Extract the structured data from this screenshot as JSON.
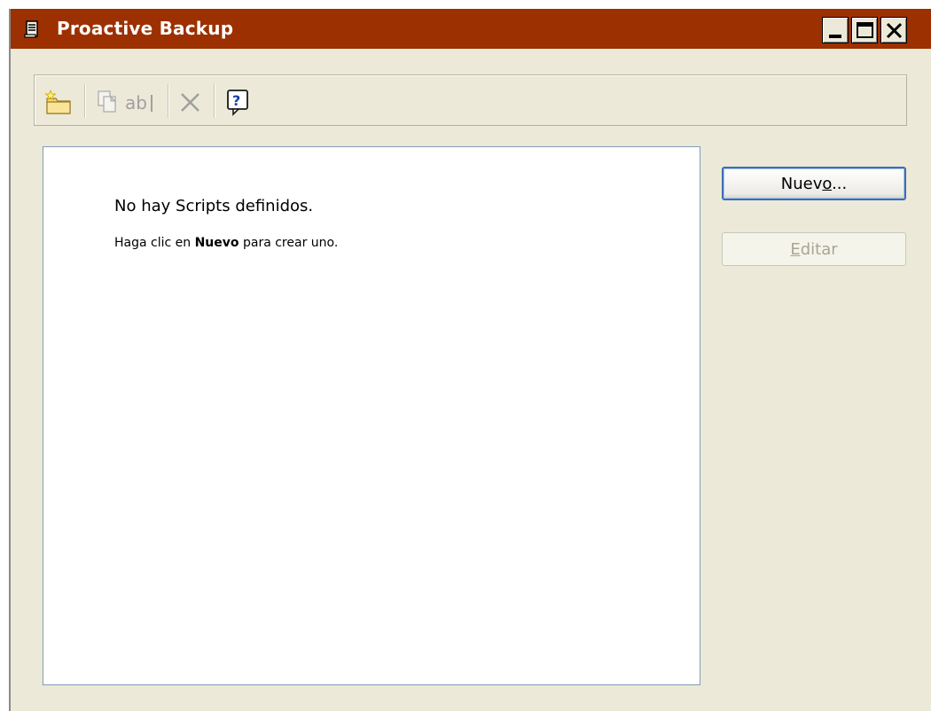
{
  "window": {
    "title": "Proactive Backup",
    "title_bar_color": "#9c3000",
    "controls": [
      "minimize-icon",
      "maximize-icon",
      "close-icon"
    ]
  },
  "toolbar": {
    "items": [
      {
        "name": "new-script-icon",
        "enabled": true
      },
      {
        "name": "copy-icon",
        "enabled": false
      },
      {
        "name": "rename-icon",
        "label": "ab",
        "enabled": false
      },
      {
        "name": "delete-icon",
        "enabled": false
      },
      {
        "name": "help-icon",
        "label": "?",
        "enabled": true
      }
    ]
  },
  "list": {
    "empty_title": "No hay Scripts definidos.",
    "hint_prefix": "Haga clic en ",
    "hint_bold": "Nuevo",
    "hint_suffix": " para crear uno."
  },
  "buttons": {
    "nuevo_pre": "Nuev",
    "nuevo_mnemonic": "o",
    "nuevo_post": "...",
    "editar_mnemonic": "E",
    "editar_post": "ditar",
    "editar_enabled": false
  }
}
